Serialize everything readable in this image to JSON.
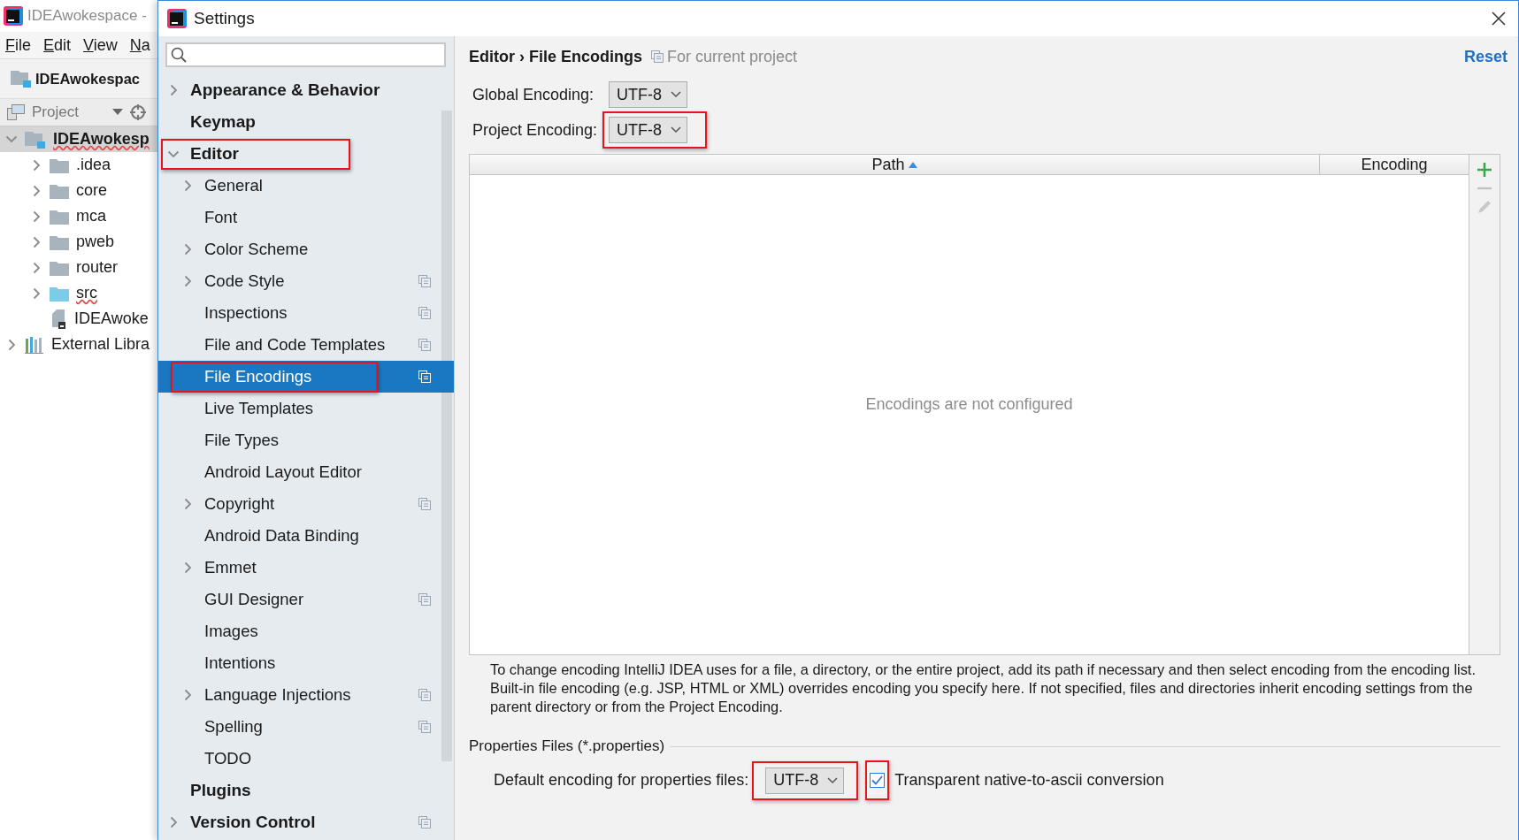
{
  "ide": {
    "title": "IDEAwokespace -",
    "menu": [
      "File",
      "Edit",
      "View",
      "Na"
    ],
    "nav_label": "IDEAwokespac",
    "tool_window": {
      "title": "Project"
    },
    "tree": [
      {
        "label": "IDEAwokesp",
        "kind": "module",
        "expanded": true,
        "selected": true,
        "children": [
          {
            "label": ".idea",
            "kind": "folder",
            "expanded": false,
            "selected": false
          },
          {
            "label": "core",
            "kind": "folder",
            "expanded": false,
            "selected": false
          },
          {
            "label": "mca",
            "kind": "folder",
            "expanded": false,
            "selected": false
          },
          {
            "label": "pweb",
            "kind": "folder",
            "expanded": false,
            "selected": false
          },
          {
            "label": "router",
            "kind": "folder",
            "expanded": false,
            "selected": false
          },
          {
            "label": "src",
            "kind": "source",
            "expanded": false,
            "selected": false
          },
          {
            "label": "IDEAwoke",
            "kind": "file",
            "selected": false
          }
        ]
      },
      {
        "label": "External Libra",
        "kind": "library",
        "expanded": false,
        "selected": false
      }
    ]
  },
  "dialog": {
    "title": "Settings",
    "sidebar": [
      {
        "label": "Appearance & Behavior",
        "expanded": false,
        "selected": false,
        "project_scope": false,
        "annotated": false
      },
      {
        "label": "Keymap",
        "selected": false,
        "project_scope": false,
        "annotated": false
      },
      {
        "label": "Editor",
        "expanded": true,
        "selected": false,
        "project_scope": false,
        "annotated": true,
        "children": [
          {
            "label": "General",
            "expanded": false,
            "selected": false,
            "project_scope": false,
            "annotated": false
          },
          {
            "label": "Font",
            "selected": false,
            "project_scope": false,
            "annotated": false
          },
          {
            "label": "Color Scheme",
            "expanded": false,
            "selected": false,
            "project_scope": false,
            "annotated": false
          },
          {
            "label": "Code Style",
            "expanded": false,
            "selected": false,
            "project_scope": true,
            "annotated": false
          },
          {
            "label": "Inspections",
            "selected": false,
            "project_scope": true,
            "annotated": false
          },
          {
            "label": "File and Code Templates",
            "selected": false,
            "project_scope": true,
            "annotated": false
          },
          {
            "label": "File Encodings",
            "selected": true,
            "project_scope": true,
            "annotated": true
          },
          {
            "label": "Live Templates",
            "selected": false,
            "project_scope": false,
            "annotated": false
          },
          {
            "label": "File Types",
            "selected": false,
            "project_scope": false,
            "annotated": false
          },
          {
            "label": "Android Layout Editor",
            "selected": false,
            "project_scope": false,
            "annotated": false
          },
          {
            "label": "Copyright",
            "expanded": false,
            "selected": false,
            "project_scope": true,
            "annotated": false
          },
          {
            "label": "Android Data Binding",
            "selected": false,
            "project_scope": false,
            "annotated": false
          },
          {
            "label": "Emmet",
            "expanded": false,
            "selected": false,
            "project_scope": false,
            "annotated": false
          },
          {
            "label": "GUI Designer",
            "selected": false,
            "project_scope": true,
            "annotated": false
          },
          {
            "label": "Images",
            "selected": false,
            "project_scope": false,
            "annotated": false
          },
          {
            "label": "Intentions",
            "selected": false,
            "project_scope": false,
            "annotated": false
          },
          {
            "label": "Language Injections",
            "expanded": false,
            "selected": false,
            "project_scope": true,
            "annotated": false
          },
          {
            "label": "Spelling",
            "selected": false,
            "project_scope": true,
            "annotated": false
          },
          {
            "label": "TODO",
            "selected": false,
            "project_scope": false,
            "annotated": false
          }
        ]
      },
      {
        "label": "Plugins",
        "selected": false,
        "project_scope": false,
        "annotated": false
      },
      {
        "label": "Version Control",
        "expanded": false,
        "selected": false,
        "project_scope": true,
        "annotated": false
      }
    ],
    "panel": {
      "breadcrumb": "Editor › File Encodings",
      "scope": "For current project",
      "reset": "Reset",
      "encodings": [
        {
          "label": "Global Encoding:",
          "value": "UTF-8",
          "annotated": false
        },
        {
          "label": "Project Encoding:",
          "value": "UTF-8",
          "annotated": true
        }
      ],
      "table": {
        "columns": [
          {
            "label": "Path",
            "sorted": true
          },
          {
            "label": "Encoding",
            "sorted": false
          }
        ],
        "empty_text": "Encodings are not configured",
        "tools": [
          {
            "kind": "add",
            "disabled": false
          },
          {
            "kind": "remove",
            "disabled": true
          },
          {
            "kind": "edit",
            "disabled": true
          }
        ]
      },
      "description": "To change encoding IntelliJ IDEA uses for a file, a directory, or the entire project, add its path if necessary and then select encoding from the encoding list. Built-in file encoding (e.g. JSP, HTML or XML) overrides encoding you specify here. If not specified, files and directories inherit encoding settings from the parent directory or from the Project Encoding.",
      "properties": {
        "title": "Properties Files (*.properties)",
        "label": "Default encoding for properties files:",
        "value": "UTF-8",
        "value_annotated": true,
        "checkbox": {
          "label": "Transparent native-to-ascii conversion",
          "checked": true,
          "annotated": true
        }
      }
    }
  }
}
